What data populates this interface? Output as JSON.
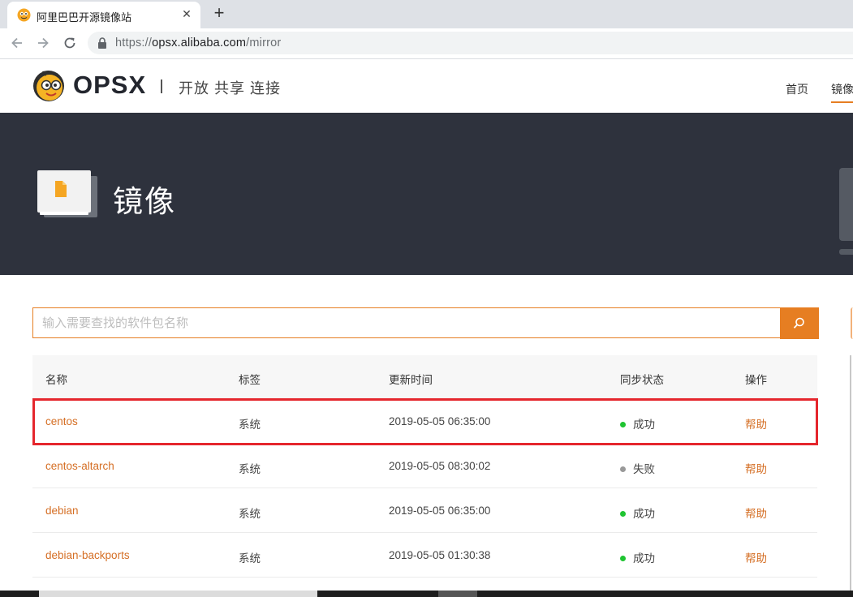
{
  "browser": {
    "tab_title": "阿里巴巴开源镜像站",
    "tab_close": "✕",
    "new_tab": "+",
    "url_scheme": "https://",
    "url_host": "opsx.alibaba.com",
    "url_path": "/mirror"
  },
  "header": {
    "logo_text": "OPSX",
    "slogan": "开放 共享 连接",
    "nav": {
      "home": "首页",
      "mirror": "镜像"
    },
    "accent_color": "#e67e22"
  },
  "banner": {
    "title": "镜像"
  },
  "search": {
    "placeholder": "输入需要查找的软件包名称",
    "value": ""
  },
  "table": {
    "columns": {
      "name": "名称",
      "tag": "标签",
      "updated": "更新时间",
      "status": "同步状态",
      "action": "操作"
    },
    "rows": [
      {
        "name": "centos",
        "tag": "系统",
        "updated": "2019-05-05 06:35:00",
        "status": "成功",
        "status_color": "#1fc431",
        "action": "帮助"
      },
      {
        "name": "centos-altarch",
        "tag": "系统",
        "updated": "2019-05-05 08:30:02",
        "status": "失败",
        "status_color": "#999999",
        "action": "帮助"
      },
      {
        "name": "debian",
        "tag": "系统",
        "updated": "2019-05-05 06:35:00",
        "status": "成功",
        "status_color": "#1fc431",
        "action": "帮助"
      },
      {
        "name": "debian-backports",
        "tag": "系统",
        "updated": "2019-05-05 01:30:38",
        "status": "成功",
        "status_color": "#1fc431",
        "action": "帮助"
      }
    ]
  }
}
